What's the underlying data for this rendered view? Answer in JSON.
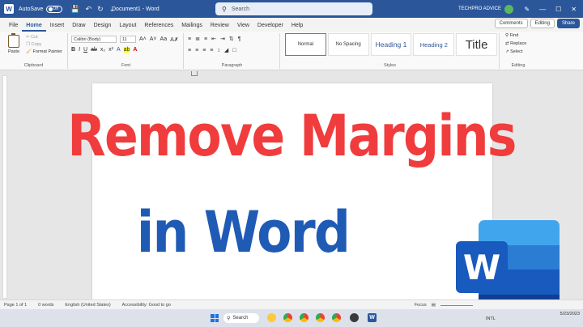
{
  "titlebar": {
    "autosave_label": "AutoSave",
    "autosave_state": "Off",
    "document_title": "Document1 - Word",
    "search_placeholder": "Search",
    "user_name": "TECHPRO ADVICE"
  },
  "tabs": [
    "File",
    "Home",
    "Insert",
    "Draw",
    "Design",
    "Layout",
    "References",
    "Mailings",
    "Review",
    "View",
    "Developer",
    "Help"
  ],
  "active_tab": "Home",
  "tab_actions": {
    "comments": "Comments",
    "editing": "Editing",
    "share": "Share"
  },
  "ribbon": {
    "clipboard": {
      "paste": "Paste",
      "cut": "Cut",
      "copy": "Copy",
      "format_painter": "Format Painter",
      "label": "Clipboard"
    },
    "font": {
      "name": "Calibri (Body)",
      "size": "11",
      "label": "Font"
    },
    "paragraph": {
      "label": "Paragraph"
    },
    "styles": {
      "items": [
        "Normal",
        "No Spacing",
        "Heading 1",
        "Heading 2",
        "Title"
      ],
      "label": "Styles"
    },
    "editing": {
      "find": "Find",
      "replace": "Replace",
      "select": "Select",
      "label": "Editing"
    }
  },
  "overlay": {
    "line1": "Remove Margins",
    "line2": "in Word",
    "line1_color": "#f03c3c",
    "line2_color": "#1f5bb5"
  },
  "logo": {
    "letter": "W"
  },
  "statusbar": {
    "page": "Page 1 of 1",
    "words": "0 words",
    "language": "English (United States)",
    "accessibility": "Accessibility: Good to go",
    "focus": "Focus",
    "zoom": "94%"
  },
  "taskbar": {
    "search": "Search",
    "locale": "INTL",
    "time": "",
    "date": "5/23/2023"
  },
  "colors": {
    "accent": "#2b579a",
    "ribbon_bg": "#f9f9f9"
  }
}
